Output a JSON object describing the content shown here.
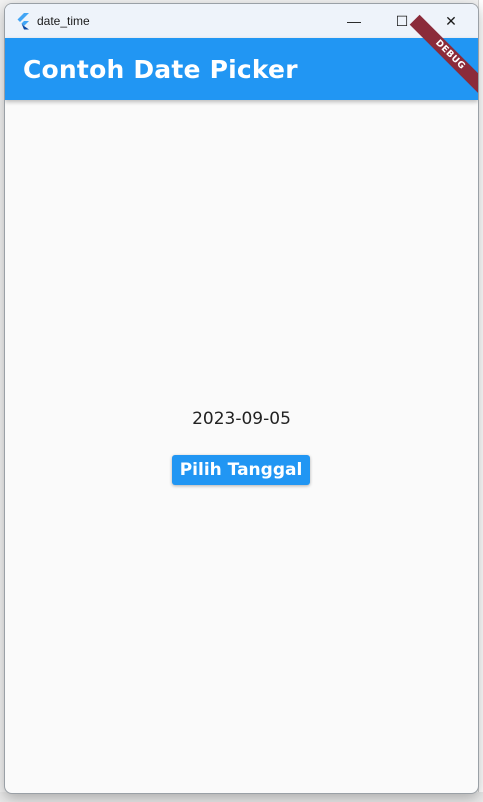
{
  "window": {
    "title": "date_time",
    "minimize_icon": "minimize-icon",
    "maximize_icon": "maximize-icon",
    "close_icon": "close-icon",
    "minimize_glyph": "—",
    "maximize_glyph": "☐",
    "close_glyph": "✕"
  },
  "appbar": {
    "title": "Contoh Date Picker",
    "debug_banner": "DEBUG",
    "color": "#2196f3"
  },
  "main": {
    "date_text": "2023-09-05",
    "button_label": "Pilih Tanggal"
  }
}
